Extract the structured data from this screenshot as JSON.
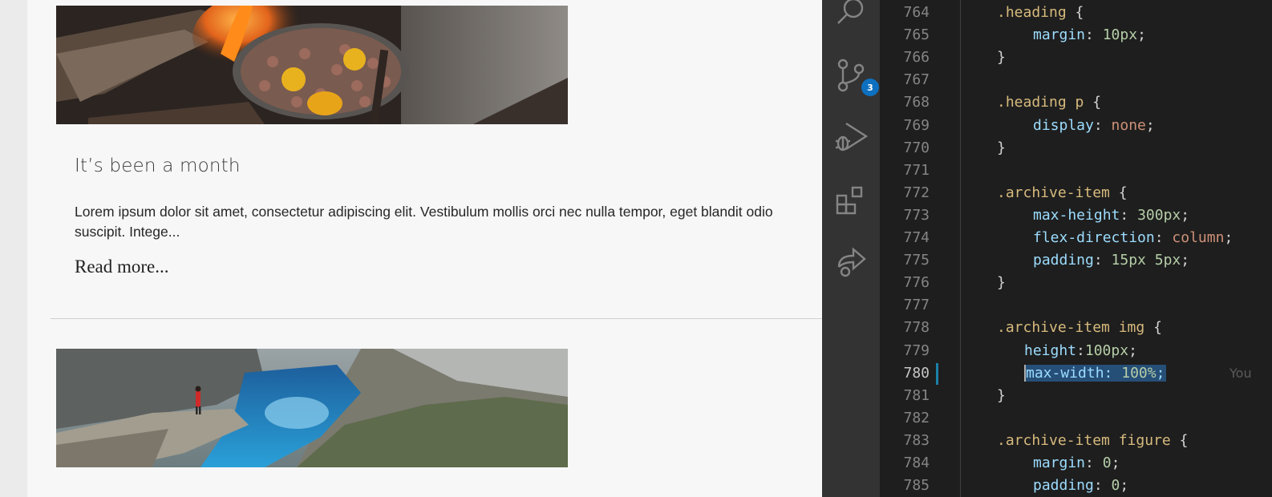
{
  "browser": {
    "post": {
      "title": "It’s been a month",
      "excerpt": "Lorem ipsum dolor sit amet, consectetur adipiscing elit. Vestibulum mollis orci nec nulla tempor, eget blandit odio suscipit. Intege...",
      "read_more": "Read more..."
    }
  },
  "activity_bar": {
    "items": [
      "search-icon",
      "source-control-icon",
      "run-debug-icon",
      "extensions-icon",
      "live-share-icon"
    ],
    "source_control_badge": "3"
  },
  "editor": {
    "lines": [
      {
        "n": "764",
        "sel": ".heading",
        "brace": " {"
      },
      {
        "n": "765",
        "prop": "margin",
        "val": "10px",
        "kind": "num"
      },
      {
        "n": "766",
        "close": "}"
      },
      {
        "n": "767"
      },
      {
        "n": "768",
        "sel": ".heading p",
        "brace": " {"
      },
      {
        "n": "769",
        "prop": "display",
        "val": "none",
        "kind": "str"
      },
      {
        "n": "770",
        "close": "}"
      },
      {
        "n": "771"
      },
      {
        "n": "772",
        "sel": ".archive-item",
        "brace": " {"
      },
      {
        "n": "773",
        "prop": "max-height",
        "val": "300px",
        "kind": "num"
      },
      {
        "n": "774",
        "prop": "flex-direction",
        "val": "column",
        "kind": "str"
      },
      {
        "n": "775",
        "prop": "padding",
        "val": "15px 5px",
        "kind": "num"
      },
      {
        "n": "776",
        "close": "}"
      },
      {
        "n": "777"
      },
      {
        "n": "778",
        "sel": ".archive-item img",
        "brace": " {"
      },
      {
        "n": "779",
        "prop": "height",
        "val": "100px",
        "kind": "num",
        "tight": true
      },
      {
        "n": "780",
        "prop": "max-width",
        "val": "100%",
        "kind": "num",
        "selected": true
      },
      {
        "n": "781",
        "close": "}"
      },
      {
        "n": "782"
      },
      {
        "n": "783",
        "sel": ".archive-item figure",
        "brace": " {"
      },
      {
        "n": "784",
        "prop": "margin",
        "val": "0",
        "kind": "num"
      },
      {
        "n": "785",
        "prop": "padding",
        "val": "0",
        "kind": "num"
      }
    ],
    "blame_text": "You"
  },
  "colors": {
    "selector": "#d7ba7d",
    "property": "#9cdcfe",
    "number": "#b5cea8",
    "string": "#ce9178",
    "selection": "#264f78",
    "badge": "#0e70c0"
  }
}
